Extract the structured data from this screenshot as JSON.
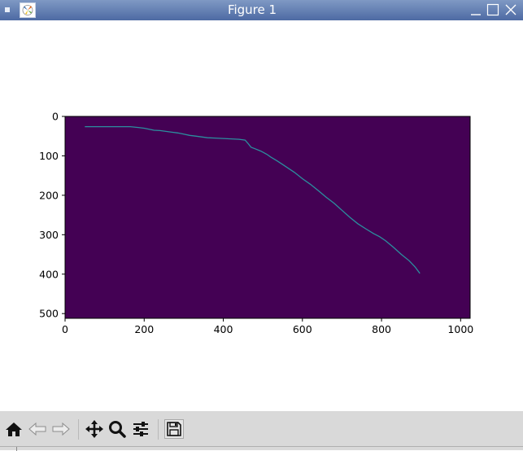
{
  "window": {
    "title": "Figure 1",
    "titlebar_color": "#4d6aa3"
  },
  "icons": {
    "menu": "window-menu-icon",
    "app": "matplotlib-app-icon",
    "minimize": "minimize-icon",
    "maximize": "maximize-icon",
    "close": "close-icon"
  },
  "toolbar": {
    "buttons": [
      "home-icon",
      "back-arrow-icon",
      "forward-arrow-icon",
      "pan-move-icon",
      "zoom-magnifier-icon",
      "configure-subplots-icon",
      "save-floppy-icon"
    ]
  },
  "chart_data": {
    "type": "line",
    "title": "",
    "xlabel": "",
    "ylabel": "",
    "background_image_color": "#440154",
    "line_color": "#2b8f9e",
    "xlim": [
      0,
      1024
    ],
    "ylim": [
      512,
      0
    ],
    "y_inverted": true,
    "x_ticks": [
      "0",
      "200",
      "400",
      "600",
      "800",
      "1000"
    ],
    "y_ticks": [
      "0",
      "100",
      "200",
      "300",
      "400",
      "500"
    ],
    "x_tick_values": [
      0,
      200,
      400,
      600,
      800,
      1000
    ],
    "y_tick_values": [
      0,
      100,
      200,
      300,
      400,
      500
    ],
    "x": [
      50,
      80,
      110,
      140,
      165,
      185,
      200,
      215,
      225,
      240,
      255,
      270,
      285,
      300,
      315,
      330,
      345,
      360,
      380,
      400,
      420,
      440,
      455,
      462,
      470,
      480,
      495,
      510,
      520,
      535,
      550,
      565,
      580,
      600,
      620,
      640,
      660,
      680,
      700,
      720,
      740,
      760,
      780,
      795,
      810,
      830,
      850,
      870,
      885,
      897
    ],
    "y": [
      26,
      26,
      26,
      26,
      26,
      28,
      30,
      33,
      35,
      36,
      38,
      40,
      42,
      45,
      48,
      50,
      52,
      54,
      55,
      56,
      57,
      58,
      60,
      68,
      78,
      82,
      88,
      96,
      103,
      112,
      122,
      132,
      142,
      158,
      172,
      188,
      205,
      220,
      238,
      256,
      272,
      285,
      297,
      305,
      315,
      332,
      350,
      366,
      382,
      398
    ]
  }
}
